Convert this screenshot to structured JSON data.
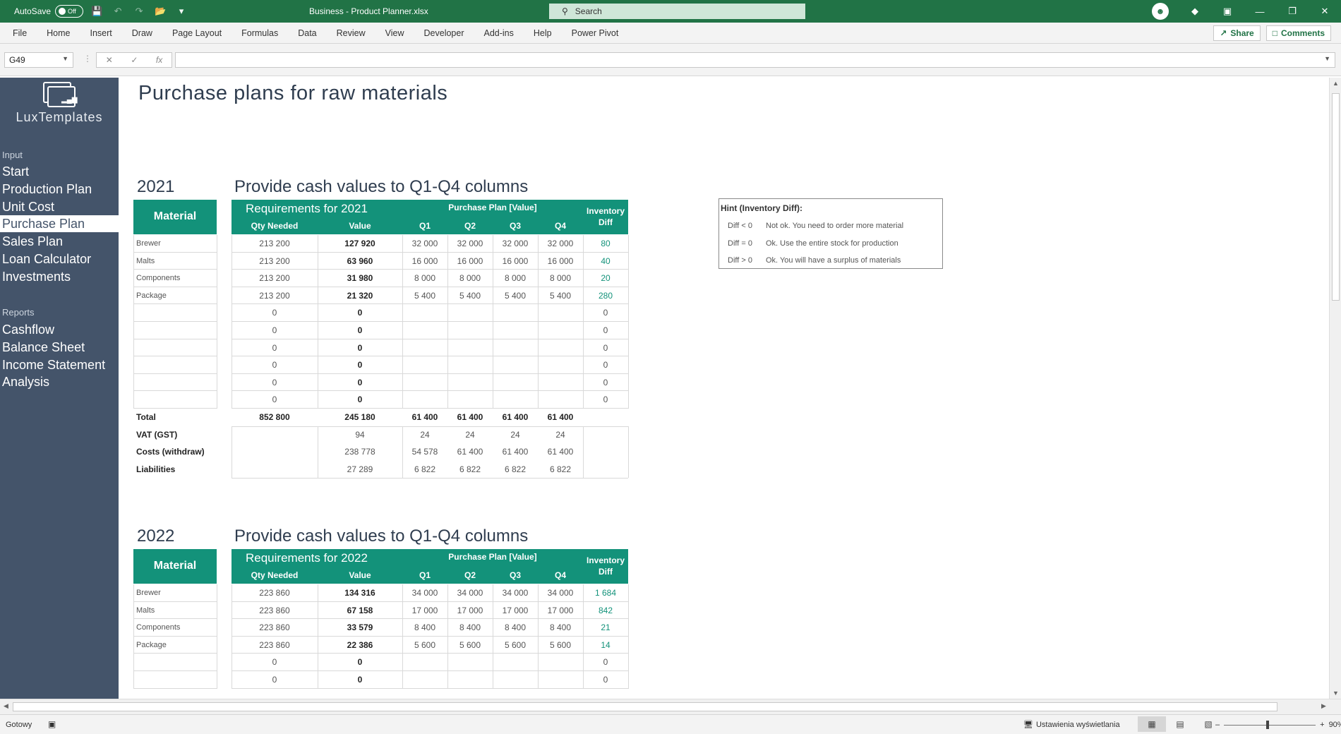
{
  "titlebar": {
    "autosave_label": "AutoSave",
    "autosave_state": "Off",
    "document_title": "Business - Product Planner.xlsx",
    "search_placeholder": "Search"
  },
  "menu": [
    "File",
    "Home",
    "Insert",
    "Draw",
    "Page Layout",
    "Formulas",
    "Data",
    "Review",
    "View",
    "Developer",
    "Add-ins",
    "Help",
    "Power Pivot"
  ],
  "ribbon_right": {
    "share": "Share",
    "comments": "Comments"
  },
  "formula_bar": {
    "name_box": "G49",
    "formula": ""
  },
  "sidebar": {
    "logo_text": "LuxTemplates",
    "input_label": "Input",
    "input_items": [
      "Start",
      "Production Plan",
      "Unit Cost",
      "Purchase Plan",
      "Sales Plan",
      "Loan Calculator",
      "Investments"
    ],
    "active_item": "Purchase Plan",
    "reports_label": "Reports",
    "report_items": [
      "Cashflow",
      "Balance Sheet",
      "Income Statement",
      "Analysis"
    ]
  },
  "sheet": {
    "title": "Purchase plans for raw materials",
    "headers": {
      "material": "Material",
      "qty_needed": "Qty Needed",
      "value": "Value",
      "purchase_plan": "Purchase Plan [Value]",
      "q1": "Q1",
      "q2": "Q2",
      "q3": "Q3",
      "q4": "Q4",
      "inventory": "Inventory",
      "diff": "Diff"
    },
    "sections": [
      {
        "year": "2021",
        "subtitle": "Provide cash values to Q1-Q4 columns",
        "requirements": "Requirements for 2021",
        "rows": [
          {
            "material": "Brewer",
            "qty": "213 200",
            "value": "127 920",
            "q1": "32 000",
            "q2": "32 000",
            "q3": "32 000",
            "q4": "32 000",
            "diff": "80"
          },
          {
            "material": "Malts",
            "qty": "213 200",
            "value": "63 960",
            "q1": "16 000",
            "q2": "16 000",
            "q3": "16 000",
            "q4": "16 000",
            "diff": "40"
          },
          {
            "material": "Components",
            "qty": "213 200",
            "value": "31 980",
            "q1": "8 000",
            "q2": "8 000",
            "q3": "8 000",
            "q4": "8 000",
            "diff": "20"
          },
          {
            "material": "Package",
            "qty": "213 200",
            "value": "21 320",
            "q1": "5 400",
            "q2": "5 400",
            "q3": "5 400",
            "q4": "5 400",
            "diff": "280"
          },
          {
            "material": "",
            "qty": "0",
            "value": "0",
            "q1": "",
            "q2": "",
            "q3": "",
            "q4": "",
            "diff": "0"
          },
          {
            "material": "",
            "qty": "0",
            "value": "0",
            "q1": "",
            "q2": "",
            "q3": "",
            "q4": "",
            "diff": "0"
          },
          {
            "material": "",
            "qty": "0",
            "value": "0",
            "q1": "",
            "q2": "",
            "q3": "",
            "q4": "",
            "diff": "0"
          },
          {
            "material": "",
            "qty": "0",
            "value": "0",
            "q1": "",
            "q2": "",
            "q3": "",
            "q4": "",
            "diff": "0"
          },
          {
            "material": "",
            "qty": "0",
            "value": "0",
            "q1": "",
            "q2": "",
            "q3": "",
            "q4": "",
            "diff": "0"
          },
          {
            "material": "",
            "qty": "0",
            "value": "0",
            "q1": "",
            "q2": "",
            "q3": "",
            "q4": "",
            "diff": "0"
          }
        ],
        "total": {
          "label": "Total",
          "qty": "852 800",
          "value": "245 180",
          "q1": "61 400",
          "q2": "61 400",
          "q3": "61 400",
          "q4": "61 400"
        },
        "extras": [
          {
            "label": "VAT (GST)",
            "value": "94",
            "q1": "24",
            "q2": "24",
            "q3": "24",
            "q4": "24"
          },
          {
            "label": "Costs (withdraw)",
            "value": "238 778",
            "q1": "54 578",
            "q2": "61 400",
            "q3": "61 400",
            "q4": "61 400"
          },
          {
            "label": "Liabilities",
            "value": "27 289",
            "q1": "6 822",
            "q2": "6 822",
            "q3": "6 822",
            "q4": "6 822"
          }
        ]
      },
      {
        "year": "2022",
        "subtitle": "Provide cash values to Q1-Q4 columns",
        "requirements": "Requirements for 2022",
        "rows": [
          {
            "material": "Brewer",
            "qty": "223 860",
            "value": "134 316",
            "q1": "34 000",
            "q2": "34 000",
            "q3": "34 000",
            "q4": "34 000",
            "diff": "1 684"
          },
          {
            "material": "Malts",
            "qty": "223 860",
            "value": "67 158",
            "q1": "17 000",
            "q2": "17 000",
            "q3": "17 000",
            "q4": "17 000",
            "diff": "842"
          },
          {
            "material": "Components",
            "qty": "223 860",
            "value": "33 579",
            "q1": "8 400",
            "q2": "8 400",
            "q3": "8 400",
            "q4": "8 400",
            "diff": "21"
          },
          {
            "material": "Package",
            "qty": "223 860",
            "value": "22 386",
            "q1": "5 600",
            "q2": "5 600",
            "q3": "5 600",
            "q4": "5 600",
            "diff": "14"
          },
          {
            "material": "",
            "qty": "0",
            "value": "0",
            "q1": "",
            "q2": "",
            "q3": "",
            "q4": "",
            "diff": "0"
          },
          {
            "material": "",
            "qty": "0",
            "value": "0",
            "q1": "",
            "q2": "",
            "q3": "",
            "q4": "",
            "diff": "0"
          }
        ]
      }
    ],
    "hint": {
      "title": "Hint (Inventory Diff):",
      "rows": [
        {
          "rule": "Diff < 0",
          "desc": "Not ok. You need to order more material"
        },
        {
          "rule": "Diff = 0",
          "desc": "Ok. Use the entire stock for production"
        },
        {
          "rule": "Diff > 0",
          "desc": "Ok. You will have a surplus of materials"
        }
      ]
    }
  },
  "statusbar": {
    "ready": "Gotowy",
    "display_settings": "Ustawienia wyświetlania",
    "zoom": "90%"
  },
  "colors": {
    "excel_green": "#217346",
    "sidebar": "#44546a",
    "header_teal": "#13927a"
  }
}
